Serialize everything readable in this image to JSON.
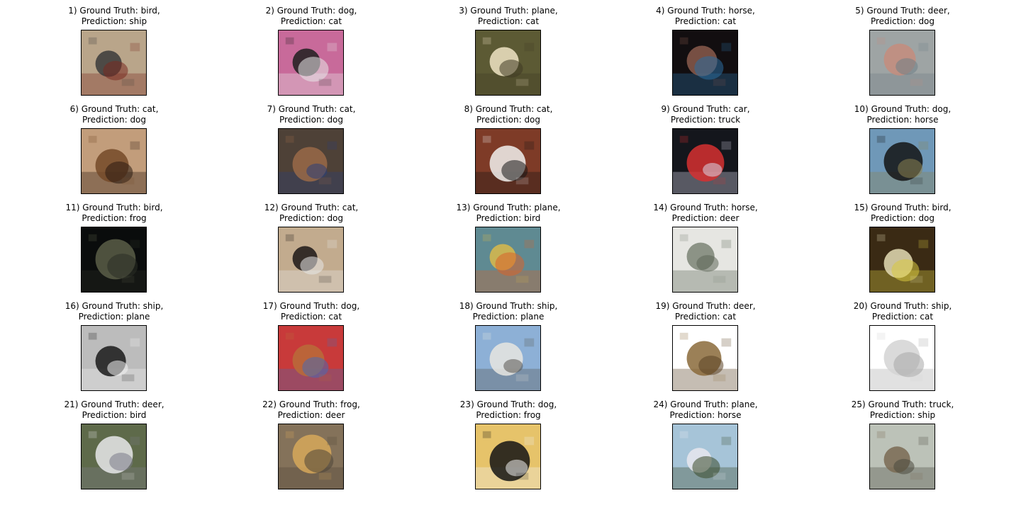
{
  "figure": {
    "items": [
      {
        "n": "1",
        "gt": "bird",
        "pred": "ship",
        "icon": "ostrich-face-image",
        "bg": "#b9a58a",
        "fg": "#3a3a3a",
        "accent": "#7a2a20"
      },
      {
        "n": "2",
        "gt": "dog",
        "pred": "cat",
        "icon": "long-haired-dog-image",
        "bg": "#c86a9a",
        "fg": "#1e1e1e",
        "accent": "#e8e8e8"
      },
      {
        "n": "3",
        "gt": "plane",
        "pred": "cat",
        "icon": "stealth-plane-image",
        "bg": "#5c5a34",
        "fg": "#efe4c4",
        "accent": "#3f3b24"
      },
      {
        "n": "4",
        "gt": "horse",
        "pred": "cat",
        "icon": "horse-head-image",
        "bg": "#120e10",
        "fg": "#8a5b4c",
        "accent": "#2b6ea0"
      },
      {
        "n": "5",
        "gt": "deer",
        "pred": "dog",
        "icon": "deer-image",
        "bg": "#9ea4a4",
        "fg": "#c48d7e",
        "accent": "#6f7f86"
      },
      {
        "n": "6",
        "gt": "cat",
        "pred": "dog",
        "icon": "brown-cat-image",
        "bg": "#c29d7b",
        "fg": "#744a28",
        "accent": "#2a1a10"
      },
      {
        "n": "7",
        "gt": "cat",
        "pred": "dog",
        "icon": "cat-on-cushion-image",
        "bg": "#4e4137",
        "fg": "#9a6a48",
        "accent": "#2c3f78"
      },
      {
        "n": "8",
        "gt": "cat",
        "pred": "dog",
        "icon": "black-white-cat-image",
        "bg": "#7e3b27",
        "fg": "#f1f1ee",
        "accent": "#151515"
      },
      {
        "n": "9",
        "gt": "car",
        "pred": "truck",
        "icon": "red-race-car-image",
        "bg": "#14161c",
        "fg": "#d63030",
        "accent": "#d8d8e8"
      },
      {
        "n": "10",
        "gt": "dog",
        "pred": "horse",
        "icon": "black-dog-image",
        "bg": "#6f98b8",
        "fg": "#141414",
        "accent": "#8c8250"
      },
      {
        "n": "11",
        "gt": "bird",
        "pred": "frog",
        "icon": "dark-bird-image",
        "bg": "#0a0c0c",
        "fg": "#5a5e48",
        "accent": "#2a2e24"
      },
      {
        "n": "12",
        "gt": "cat",
        "pred": "dog",
        "icon": "cat-lying-image",
        "bg": "#c2ab8e",
        "fg": "#1c1616",
        "accent": "#e8e8e8"
      },
      {
        "n": "13",
        "gt": "plane",
        "pred": "bird",
        "icon": "airshow-plane-image",
        "bg": "#5f8a92",
        "fg": "#d9b84a",
        "accent": "#d8622a"
      },
      {
        "n": "14",
        "gt": "horse",
        "pred": "deer",
        "icon": "horse-statue-image",
        "bg": "#e6e6e2",
        "fg": "#7b8476",
        "accent": "#5c6658"
      },
      {
        "n": "15",
        "gt": "bird",
        "pred": "dog",
        "icon": "owl-chick-image",
        "bg": "#3a2a14",
        "fg": "#e4dcb4",
        "accent": "#d8c840"
      },
      {
        "n": "16",
        "gt": "ship",
        "pred": "plane",
        "icon": "speedboat-image",
        "bg": "#bcbcbc",
        "fg": "#1a1a1a",
        "accent": "#f2f2f2"
      },
      {
        "n": "17",
        "gt": "dog",
        "pred": "cat",
        "icon": "sleeping-dog-image",
        "bg": "#c83a3a",
        "fg": "#b86c3a",
        "accent": "#4a6ab0"
      },
      {
        "n": "18",
        "gt": "ship",
        "pred": "plane",
        "icon": "yacht-image",
        "bg": "#8db0d6",
        "fg": "#e8e6e0",
        "accent": "#5a5650"
      },
      {
        "n": "19",
        "gt": "deer",
        "pred": "cat",
        "icon": "deer-on-white-image",
        "bg": "#ffffff",
        "fg": "#8a6a3a",
        "accent": "#5a4224"
      },
      {
        "n": "20",
        "gt": "ship",
        "pred": "cat",
        "icon": "white-boat-image",
        "bg": "#ffffff",
        "fg": "#d4d4d4",
        "accent": "#a8a8a8"
      },
      {
        "n": "21",
        "gt": "deer",
        "pred": "bird",
        "icon": "white-deer-image",
        "bg": "#5e6a4a",
        "fg": "#e8e8ea",
        "accent": "#7a7a88"
      },
      {
        "n": "22",
        "gt": "frog",
        "pred": "deer",
        "icon": "frog-on-rock-image",
        "bg": "#84725a",
        "fg": "#d6a85a",
        "accent": "#4f4638"
      },
      {
        "n": "23",
        "gt": "dog",
        "pred": "frog",
        "icon": "cow-pattern-dog-image",
        "bg": "#e6c36a",
        "fg": "#141414",
        "accent": "#f1f1f1"
      },
      {
        "n": "24",
        "gt": "plane",
        "pred": "horse",
        "icon": "plane-front-image",
        "bg": "#a6c4d8",
        "fg": "#e8e8ee",
        "accent": "#3b4a2a"
      },
      {
        "n": "25",
        "gt": "truck",
        "pred": "ship",
        "icon": "truck-rear-image",
        "bg": "#bcc2b8",
        "fg": "#7a6a52",
        "accent": "#4a4a3e"
      }
    ]
  }
}
